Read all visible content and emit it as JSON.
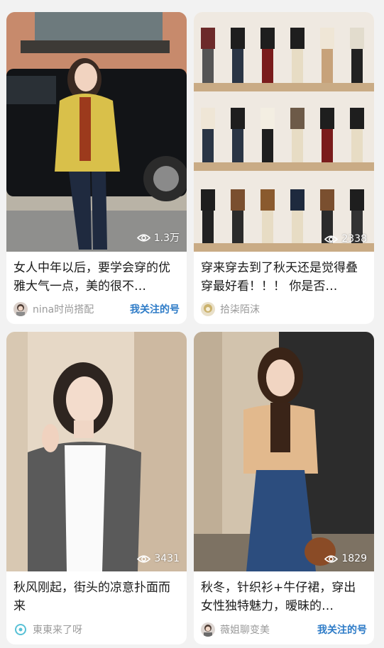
{
  "colors": {
    "page_bg": "#f2f2f2",
    "card_bg": "#ffffff",
    "follow": "#2d7bc7",
    "author": "#9a9a9a"
  },
  "cards": [
    {
      "title": "女人中年以后，要学会穿的优雅大气一点，美的很不…",
      "views": "1.3万",
      "author": "nina时尚搭配",
      "tag": "我关注的号",
      "view_icon": "eye-icon"
    },
    {
      "title": "穿来穿去到了秋天还是觉得叠穿最好看！！！ 你是否…",
      "views": "2338",
      "author": "拾柒陌沫",
      "tag": "",
      "view_icon": "eye-icon"
    },
    {
      "title": "秋风刚起，街头的凉意扑面而来",
      "views": "3431",
      "author": "東東来了呀",
      "tag": "",
      "view_icon": "eye-icon"
    },
    {
      "title": "秋冬，针织衫+牛仔裙，穿出女性独特魅力，暧昧的…",
      "views": "1829",
      "author": "薇姐聊变美",
      "tag": "我关注的号",
      "view_icon": "eye-icon"
    }
  ]
}
